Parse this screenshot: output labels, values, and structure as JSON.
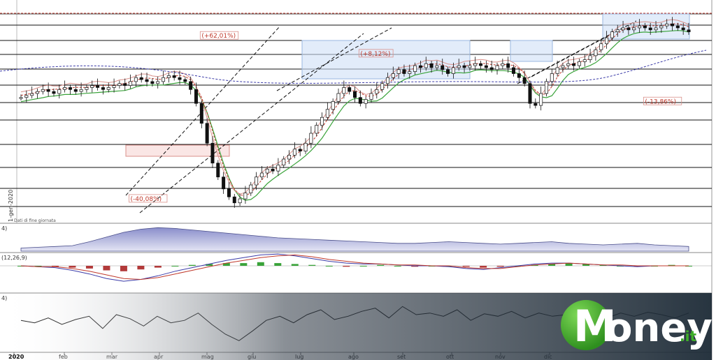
{
  "chart_data": [
    {
      "type": "candlestick",
      "title": "",
      "x_labels": [
        "2020",
        "feb",
        "mar",
        "apr",
        "mag",
        "giu",
        "lug",
        "ago",
        "set",
        "ott",
        "nov",
        "dic"
      ],
      "date_label": "1-gen-2020",
      "footer_note": "Dati di fine giornata",
      "ylim": [
        0,
        100
      ],
      "grid": false,
      "price_series_index": [
        58,
        59,
        60,
        61,
        62,
        61,
        60,
        62,
        63,
        62,
        61,
        62,
        63,
        64,
        63,
        62,
        63,
        64,
        65,
        64,
        66,
        68,
        67,
        66,
        65,
        66,
        68,
        69,
        68,
        67,
        66,
        62,
        55,
        45,
        35,
        25,
        18,
        12,
        8,
        5,
        7,
        10,
        14,
        18,
        20,
        22,
        21,
        24,
        27,
        29,
        32,
        31,
        35,
        40,
        44,
        48,
        52,
        56,
        60,
        63,
        61,
        58,
        55,
        57,
        60,
        62,
        65,
        68,
        70,
        72,
        70,
        71,
        74,
        73,
        75,
        73,
        74,
        72,
        70,
        73,
        74,
        73,
        74,
        75,
        74,
        73,
        72,
        74,
        75,
        73,
        70,
        68,
        65,
        55,
        54,
        60,
        66,
        70,
        73,
        74,
        75,
        74,
        76,
        77,
        79,
        82,
        85,
        88,
        91,
        92,
        93,
        92,
        93,
        94,
        93,
        92,
        93,
        94,
        95,
        94,
        93,
        92,
        91
      ],
      "annotations": [
        {
          "text": "(+62,01%)",
          "x_index": 33,
          "value": 88
        },
        {
          "text": "(+8,12%)",
          "x_index": 62,
          "value": 79
        },
        {
          "text": "(-40,08%)",
          "x_index": 20,
          "value": 6
        },
        {
          "text": "(-13,86%)",
          "x_index": 114,
          "value": 55
        }
      ]
    },
    {
      "type": "area",
      "panel_label": "4)",
      "values": [
        4,
        5,
        6,
        7,
        12,
        18,
        24,
        28,
        30,
        29,
        27,
        25,
        23,
        21,
        19,
        17,
        16,
        15,
        14,
        13,
        12,
        11,
        10,
        10,
        11,
        12,
        11,
        10,
        9,
        10,
        11,
        12,
        10,
        9,
        8,
        9,
        10,
        8,
        7,
        6
      ],
      "ylim": [
        0,
        32
      ]
    },
    {
      "type": "bar",
      "panel_label": "(12,26,9)",
      "values": [
        0,
        0,
        -1,
        -2,
        -3,
        -5,
        -6,
        -4,
        -2,
        0,
        1,
        2,
        3,
        3,
        4,
        3,
        2,
        1,
        0,
        -1,
        0,
        1,
        0,
        -1,
        0,
        0,
        -1,
        -2,
        -1,
        0,
        1,
        2,
        3,
        2,
        1,
        0,
        -1,
        0,
        1,
        0
      ],
      "macd": [
        0,
        -1,
        -2,
        -5,
        -9,
        -14,
        -17,
        -15,
        -11,
        -6,
        -2,
        2,
        6,
        9,
        12,
        13,
        11,
        8,
        5,
        3,
        2,
        2,
        1,
        0,
        0,
        -1,
        -3,
        -4,
        -2,
        0,
        2,
        3,
        3,
        2,
        1,
        0,
        -1,
        0,
        0,
        0
      ],
      "signal": [
        0,
        -1,
        -1,
        -3,
        -6,
        -10,
        -14,
        -15,
        -13,
        -9,
        -5,
        -1,
        3,
        6,
        9,
        11,
        12,
        10,
        7,
        5,
        3,
        2,
        1,
        1,
        0,
        0,
        -2,
        -3,
        -3,
        -1,
        1,
        2,
        3,
        2,
        1,
        1,
        0,
        0,
        0,
        0
      ],
      "ylim": [
        -20,
        15
      ]
    },
    {
      "type": "line",
      "panel_label": "4)",
      "values": [
        55,
        52,
        58,
        50,
        56,
        60,
        45,
        62,
        57,
        48,
        60,
        52,
        55,
        64,
        50,
        38,
        30,
        42,
        55,
        60,
        52,
        62,
        68,
        56,
        60,
        66,
        70,
        58,
        72,
        62,
        64,
        60,
        68,
        55,
        63,
        60,
        66,
        58,
        64,
        60,
        62,
        70,
        60,
        58,
        64,
        60,
        65,
        62,
        58,
        64
      ],
      "ylim": [
        20,
        80
      ]
    }
  ],
  "brand": {
    "word": "oney",
    "initial": "M",
    "suffix": ".it",
    "colors": {
      "green": "#3fae2a",
      "dark": "#1d2b38"
    }
  }
}
